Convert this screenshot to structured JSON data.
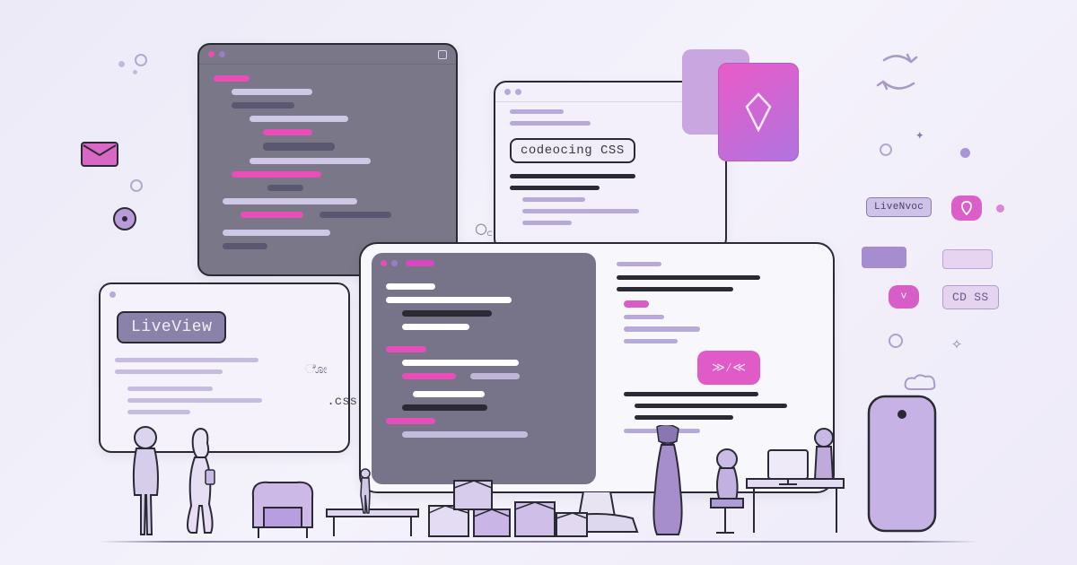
{
  "labels": {
    "liveview": "LiveView",
    "codeocing_css": "codeocing CSS",
    "css": ".css",
    "liveview_small": "LiveNvoc",
    "cdss": "CD SS"
  },
  "colors": {
    "dark_window": "#7a7788",
    "pink": "#e84db8",
    "magenta": "#d946c0",
    "purple": "#9b7bc7",
    "lavender": "#b8aad8",
    "slate": "#5a5870",
    "white": "#ffffff",
    "navy": "#2a2a35"
  }
}
